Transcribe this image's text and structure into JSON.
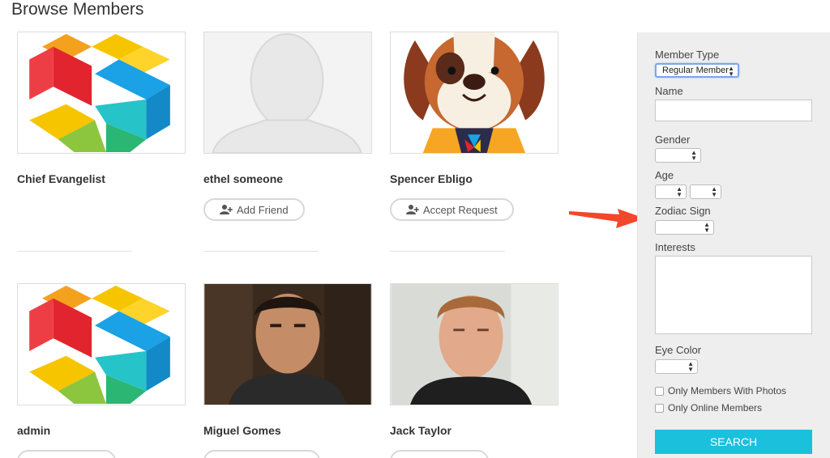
{
  "page": {
    "title": "Browse Members"
  },
  "members": [
    {
      "name": "Chief Evangelist",
      "avatar": "logo-icon",
      "button": ""
    },
    {
      "name": "ethel someone",
      "avatar": "default-avatar-icon",
      "button": "Add Friend"
    },
    {
      "name": "Spencer Ebligo",
      "avatar": "dog-avatar-icon",
      "button": "Accept Request"
    },
    {
      "name": "admin",
      "avatar": "logo-icon",
      "button": ""
    },
    {
      "name": "Miguel Gomes",
      "avatar": "photo-avatar",
      "button": ""
    },
    {
      "name": "Jack Taylor",
      "avatar": "photo-avatar",
      "button": ""
    }
  ],
  "filters": {
    "member_type": {
      "label": "Member Type",
      "value": "Regular Member"
    },
    "name": {
      "label": "Name",
      "value": ""
    },
    "gender": {
      "label": "Gender",
      "value": ""
    },
    "age": {
      "label": "Age",
      "from": "",
      "to": ""
    },
    "zodiac": {
      "label": "Zodiac Sign",
      "value": ""
    },
    "interests": {
      "label": "Interests",
      "value": ""
    },
    "eye_color": {
      "label": "Eye Color",
      "value": ""
    },
    "only_photos": {
      "label": "Only Members With Photos",
      "checked": false
    },
    "only_online": {
      "label": "Only Online Members",
      "checked": false
    },
    "search_label": "SEARCH"
  },
  "colors": {
    "accent": "#1bc0dd",
    "annotation_arrow": "#f2472b"
  }
}
